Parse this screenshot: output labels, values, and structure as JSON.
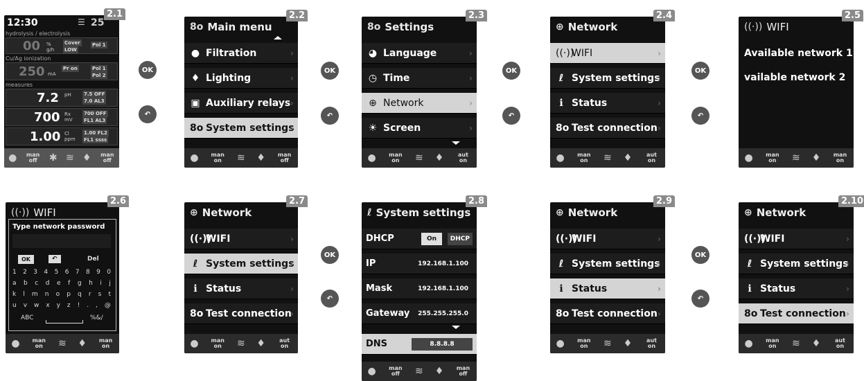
{
  "common": {
    "ok": "OK",
    "chevron": "›",
    "bar_on": "man on",
    "bar_off": "man off",
    "bar_aut_on": "aut on"
  },
  "s21": {
    "badge": "2.1",
    "time": "12:30",
    "temp": "25",
    "cap1": "hydrolysis / electrolysis",
    "val1": "00",
    "u1": "% g/h",
    "chip1a": "Cover",
    "chip1b": "LOW",
    "chip1c": "Pol 1",
    "cap2": "Cu/Ag ionization",
    "val2": "250",
    "u2": "mA",
    "chip2a": "Pr on",
    "chip2b": "Pol 1",
    "chip2c": "Pol 2",
    "cap3": "measures",
    "ph": "7.2",
    "ph_u": "pH",
    "ph_a": "7.5 OFF",
    "ph_b": "7.0 AL3",
    "rx": "700",
    "rx_u": "Rx mV",
    "rx_a": "700 OFF",
    "rx_b": "FL1 AL3",
    "cl": "1.00",
    "cl_u": "Cl ppm",
    "cl_a": "1.00 FL2",
    "cl_b": "FL1 ssss",
    "b1": "man off",
    "b2": "man off"
  },
  "s22": {
    "badge": "2.2",
    "title": "Main menu",
    "items": [
      "Filtration",
      "Lighting",
      "Auxiliary relays",
      "System settings"
    ],
    "b1": "man on",
    "b2": "man off"
  },
  "s23": {
    "badge": "2.3",
    "title": "Settings",
    "items": [
      "Language",
      "Time",
      "Network",
      "Screen"
    ],
    "b1": "man on",
    "b2": "aut on"
  },
  "s24": {
    "badge": "2.4",
    "title": "Network",
    "items": [
      "WIFI",
      "System settings",
      "Status",
      "Test connection"
    ],
    "b1": "man on",
    "b2": "aut on"
  },
  "s25": {
    "badge": "2.5",
    "title": "WIFI",
    "net1": "Available network 1",
    "net2": "vailable network 2",
    "b1": "man on",
    "b2": "man on"
  },
  "s26": {
    "badge": "2.6",
    "title": "WIFI",
    "prompt": "Type network password",
    "ok": "OK",
    "del": "Del",
    "row1": [
      "1",
      "2",
      "3",
      "4",
      "5",
      "6",
      "7",
      "8",
      "9",
      "0"
    ],
    "row2": [
      "a",
      "b",
      "c",
      "d",
      "e",
      "f",
      "g",
      "h",
      "i",
      "j"
    ],
    "row3": [
      "k",
      "l",
      "m",
      "n",
      "o",
      "p",
      "q",
      "r",
      "s",
      "t"
    ],
    "row4": [
      "u",
      "v",
      "w",
      "x",
      "y",
      "z",
      "!",
      ".",
      ",",
      "@"
    ],
    "abc": "ABC",
    "sym": "%&/",
    "b1": "man on",
    "b2": "man on"
  },
  "s27": {
    "badge": "2.7",
    "title": "Network",
    "items": [
      "WIFI",
      "System settings",
      "Status",
      "Test connection"
    ],
    "b1": "man on",
    "b2": "aut on"
  },
  "s28": {
    "badge": "2.8",
    "title": "System settings",
    "dhcp_k": "DHCP",
    "dhcp_on": "On",
    "dhcp_v": "DHCP",
    "ip_k": "IP",
    "ip_v": "192.168.1.100",
    "mask_k": "Mask",
    "mask_v": "192.168.1.100",
    "gw_k": "Gateway",
    "gw_v": "255.255.255.0",
    "dns_k": "DNS",
    "dns_v": "8.8.8.8",
    "b1": "man off",
    "b2": "man off"
  },
  "s29": {
    "badge": "2.9",
    "title": "Network",
    "items": [
      "WIFI",
      "System settings",
      "Status",
      "Test connection"
    ],
    "b1": "man on",
    "b2": "aut on"
  },
  "s210": {
    "badge": "2.10",
    "title": "Network",
    "items": [
      "WIFI",
      "System settings",
      "Status",
      "Test connection"
    ],
    "b1": "man on",
    "b2": "aut on"
  }
}
